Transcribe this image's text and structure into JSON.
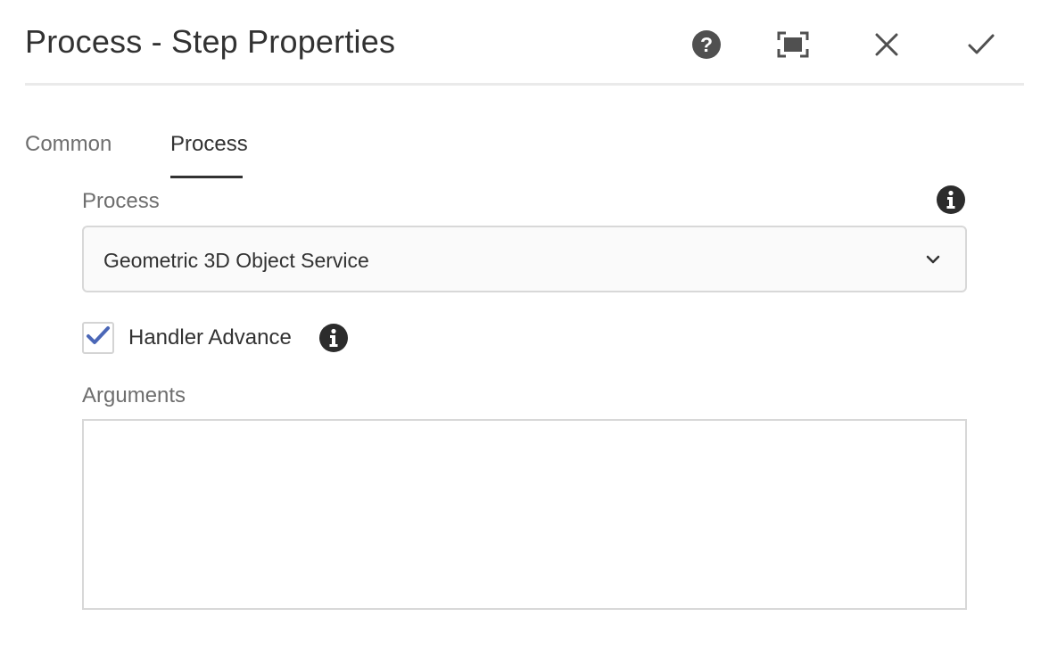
{
  "dialog": {
    "title": "Process - Step Properties"
  },
  "header_actions": {
    "help_icon": "question-circle-icon",
    "fullscreen_icon": "fullscreen-icon",
    "close_icon": "close-x-icon",
    "done_icon": "checkmark-icon"
  },
  "tabs": [
    {
      "label": "Common",
      "active": false
    },
    {
      "label": "Process",
      "active": true
    }
  ],
  "form": {
    "process": {
      "label": "Process",
      "selected": "Geometric 3D Object Service",
      "info_icon": "info-circle-icon"
    },
    "handler_advance": {
      "label": "Handler Advance",
      "checked": true,
      "info_icon": "info-circle-icon"
    },
    "arguments": {
      "label": "Arguments",
      "value": "",
      "placeholder": ""
    }
  },
  "colors": {
    "text_primary": "#323232",
    "text_secondary": "#6e6e6e",
    "icon": "#505050",
    "checkbox_check": "#4b67b7",
    "border": "#d8d8d8",
    "header_divider": "#eaeaea"
  }
}
